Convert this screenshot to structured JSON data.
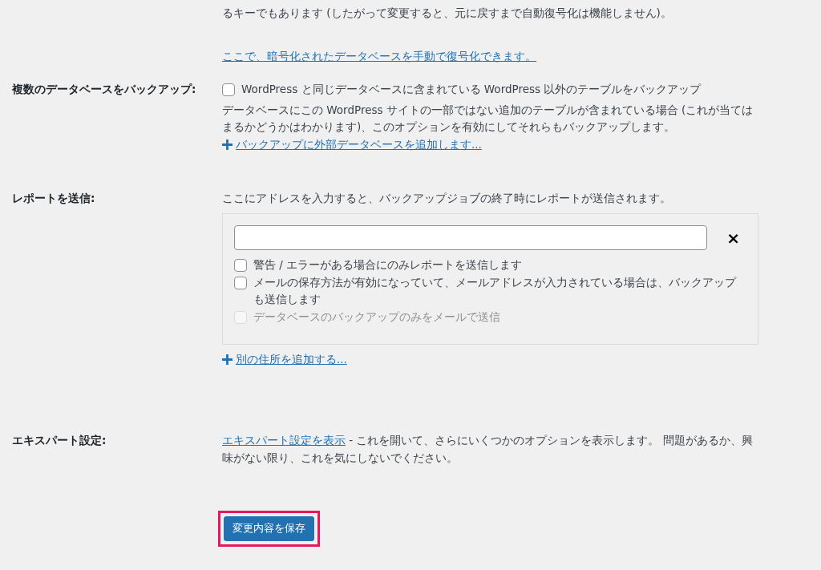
{
  "encryption": {
    "note_tail": "るキーでもあります (したがって変更すると、元に戻すまで自動復号化は機能しません)。",
    "decrypt_link": "ここで、暗号化されたデータベースを手動で復号化できます。"
  },
  "multi_db": {
    "label": "複数のデータベースをバックアップ:",
    "option": {
      "label": "WordPress と同じデータベースに含まれている WordPress 以外のテーブルをバックアップ",
      "checked": false,
      "disabled": false
    },
    "description": "データベースにこの WordPress サイトの一部ではない追加のテーブルが含まれている場合 (これが当てはまるかどうかはわかります)、このオプションを有効にしてそれらもバックアップします。",
    "add_link": "バックアップに外部データベースを追加します..."
  },
  "report": {
    "label": "レポートを送信:",
    "intro": "ここにアドレスを入力すると、バックアップジョブの終了時にレポートが送信されます。",
    "remove": "×",
    "options": [
      {
        "label": "警告 / エラーがある場合にのみレポートを送信します",
        "checked": false,
        "disabled": false
      },
      {
        "label": "メールの保存方法が有効になっていて、メールアドレスが入力されている場合は、バックアップも送信します",
        "checked": false,
        "disabled": false
      },
      {
        "label": "データベースのバックアップのみをメールで送信",
        "checked": false,
        "disabled": true
      }
    ],
    "add_link": "別の住所を追加する..."
  },
  "expert": {
    "label": "エキスパート設定:",
    "link": "エキスパート設定を表示",
    "text": " - これを開いて、さらにいくつかのオプションを表示します。 問題があるか、興味がない限り、これを気にしないでください。"
  },
  "save_button": {
    "label": "変更内容を保存",
    "highlighted": true
  }
}
